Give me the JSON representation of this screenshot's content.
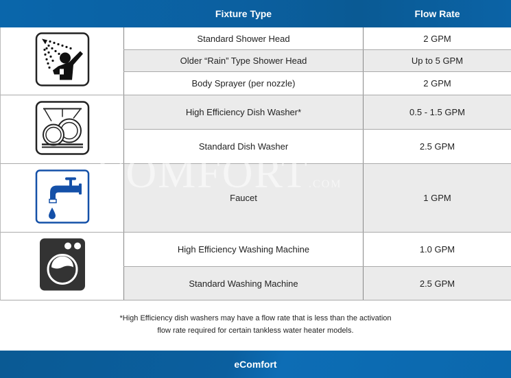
{
  "header": {
    "fixture_type": "Fixture Type",
    "flow_rate": "Flow Rate"
  },
  "groups": [
    {
      "icon": "shower-icon",
      "rows": [
        {
          "fixture": "Standard Shower Head",
          "rate": "2 GPM"
        },
        {
          "fixture": "Older “Rain” Type Shower Head",
          "rate": "Up to 5 GPM"
        },
        {
          "fixture": "Body Sprayer (per nozzle)",
          "rate": "2 GPM"
        }
      ]
    },
    {
      "icon": "dishwasher-icon",
      "rows": [
        {
          "fixture": "High Efficiency Dish Washer*",
          "rate": "0.5 - 1.5 GPM"
        },
        {
          "fixture": "Standard Dish Washer",
          "rate": "2.5 GPM"
        }
      ]
    },
    {
      "icon": "faucet-icon",
      "rows": [
        {
          "fixture": "Faucet",
          "rate": "1 GPM"
        }
      ]
    },
    {
      "icon": "washing-machine-icon",
      "rows": [
        {
          "fixture": "High Efficiency Washing Machine",
          "rate": "1.0 GPM"
        },
        {
          "fixture": "Standard Washing Machine",
          "rate": "2.5 GPM"
        }
      ]
    }
  ],
  "watermark": {
    "main": "COMFORT",
    "suffix": ".COM"
  },
  "footnote": {
    "line1": "*High Efficiency dish washers may have a flow rate that is less than the activation",
    "line2": "flow rate required for certain tankless water heater models."
  },
  "footer": {
    "brand": "eComfort"
  },
  "colors": {
    "brand_blue": "#0b5f9f",
    "faucet_blue": "#1450a8",
    "alt_row": "#ebebeb"
  }
}
